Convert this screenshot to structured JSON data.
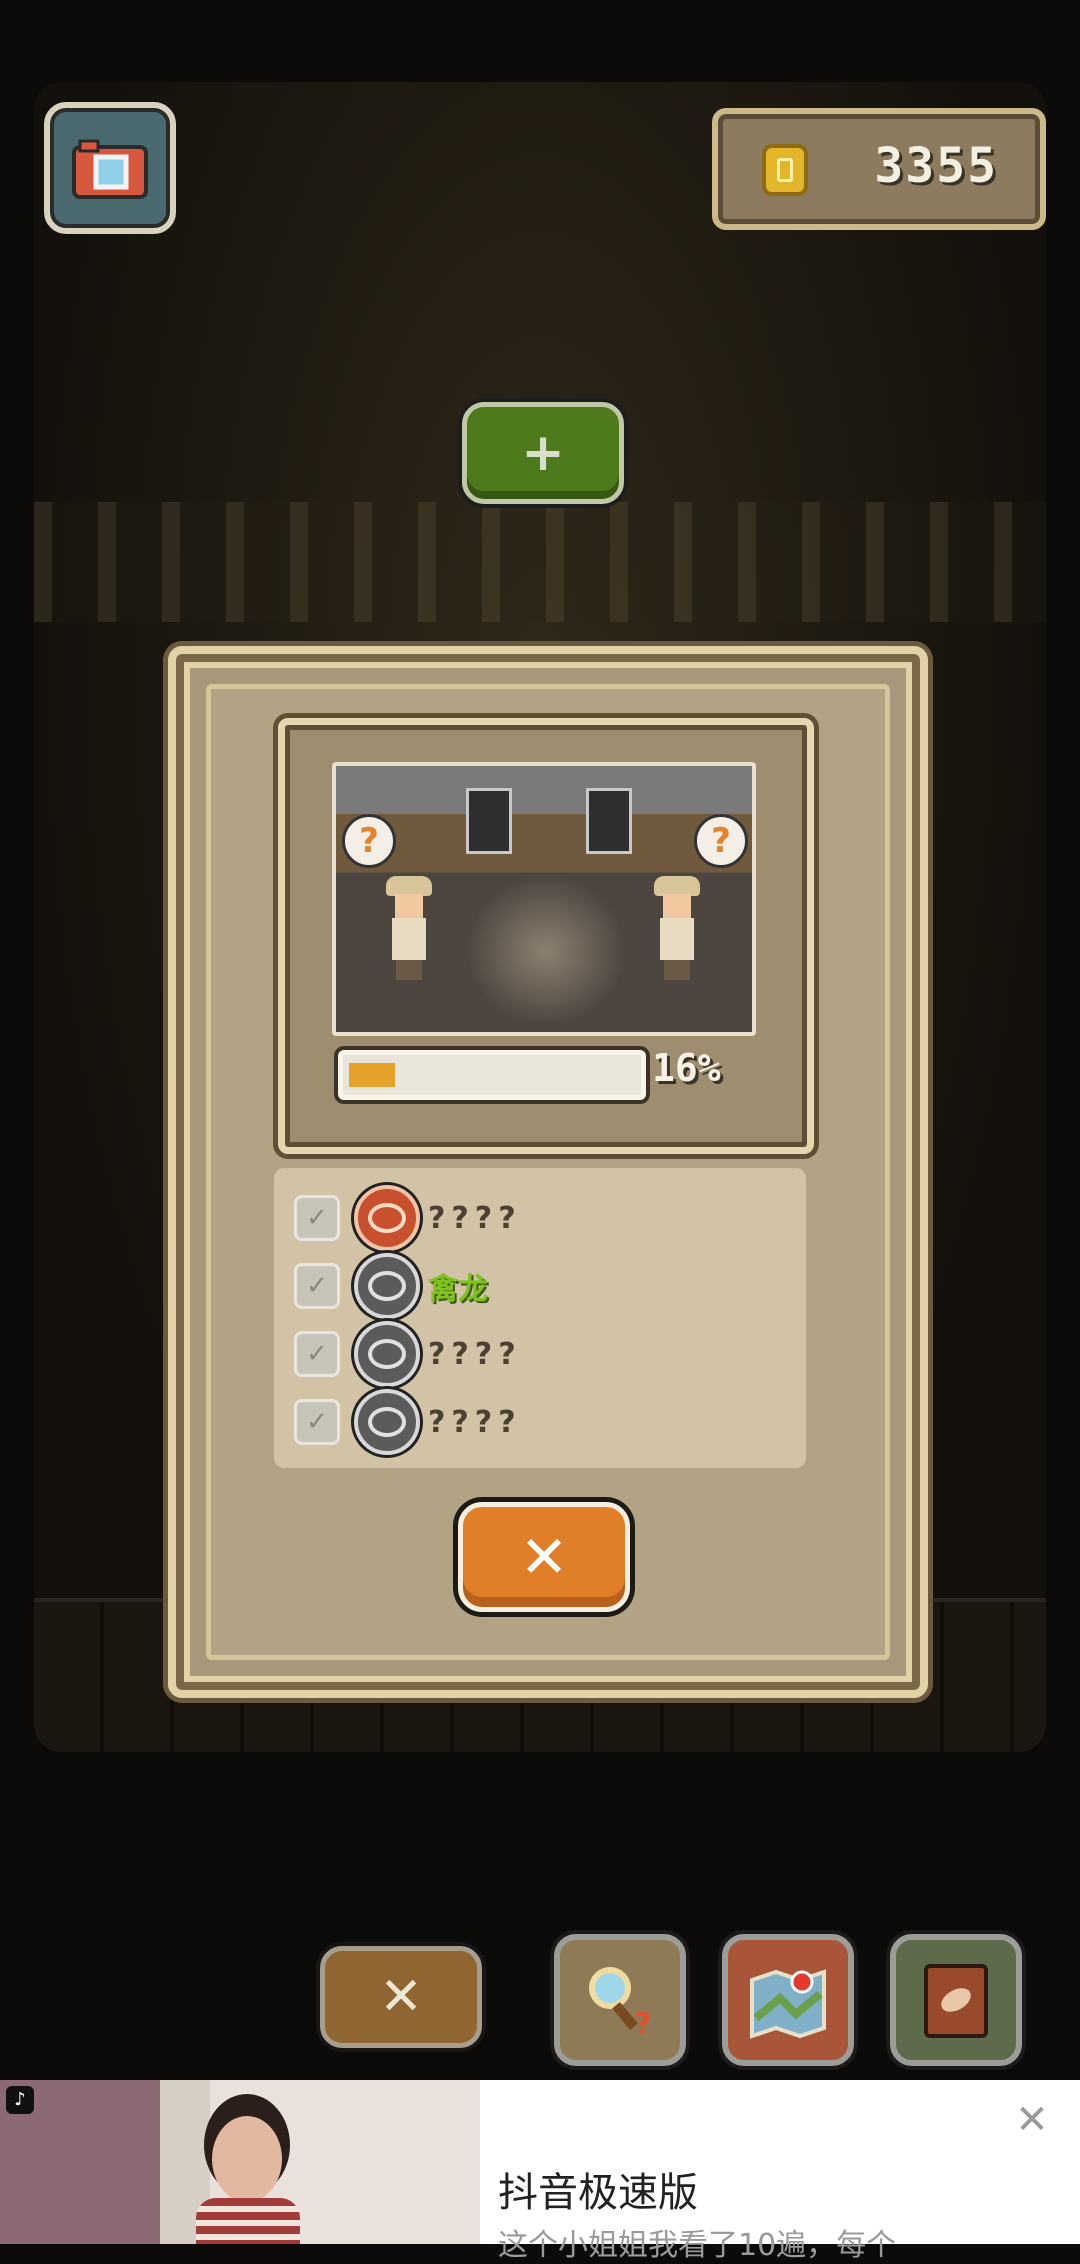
{
  "top_bar": {
    "coins": "3355",
    "add_label": "+"
  },
  "dialog": {
    "progress_percent_label": "16%",
    "progress_value": 0.16,
    "question_mark": "?",
    "items": [
      {
        "name": "????",
        "found": true
      },
      {
        "name": "禽龙",
        "found": false,
        "known": true
      },
      {
        "name": "????",
        "found": false
      },
      {
        "name": "????",
        "found": false
      }
    ],
    "close_label": "✕"
  },
  "bottom_bar": {
    "cancel_label": "✕"
  },
  "ad": {
    "title": "抖音极速版",
    "subtitle": "这个小姐姐我看了10遍，每个",
    "close_label": "✕"
  },
  "colors": {
    "accent_orange": "#e07f27",
    "accent_green": "#4e7a1c",
    "known_text": "#7fc31d",
    "progress_fill": "#e4a22a"
  }
}
